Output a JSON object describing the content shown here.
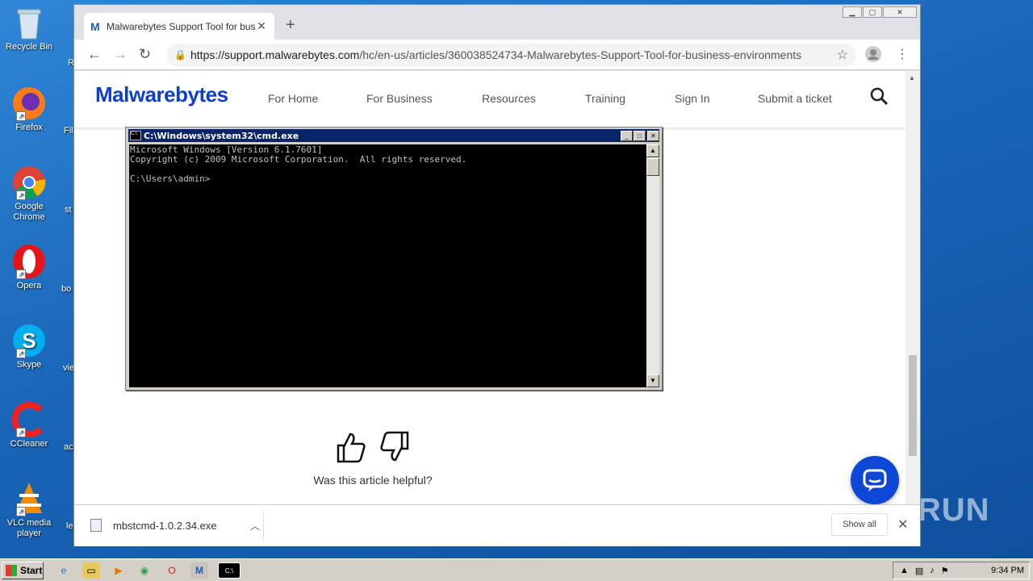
{
  "desktop": {
    "icons": [
      {
        "label": "Recycle Bin",
        "icon": "recycle-bin-icon"
      },
      {
        "label": "Firefox",
        "icon": "firefox-icon"
      },
      {
        "label": "Google Chrome",
        "icon": "chrome-icon"
      },
      {
        "label": "Opera",
        "icon": "opera-icon"
      },
      {
        "label": "Skype",
        "icon": "skype-icon"
      },
      {
        "label": "CCleaner",
        "icon": "ccleaner-icon"
      },
      {
        "label": "VLC media player",
        "icon": "vlc-icon"
      }
    ],
    "peek_labels": [
      "R",
      "Fil",
      "st",
      "bo",
      "vie",
      "ac",
      "le"
    ]
  },
  "browser": {
    "tab_title": "Malwarebytes Support Tool for busin",
    "url_host": "https://support.malwarebytes.com",
    "url_path": "/hc/en-us/articles/360038524734-Malwarebytes-Support-Tool-for-business-environments"
  },
  "site": {
    "logo": "Malwarebytes",
    "nav": [
      "For Home",
      "For Business",
      "Resources",
      "Training",
      "Sign In",
      "Submit a ticket"
    ],
    "helpful_text": "Was this article helpful?"
  },
  "downloads": {
    "file": "mbstcmd-1.0.2.34.exe",
    "show_all": "Show all"
  },
  "cmd": {
    "title": "C:\\Windows\\system32\\cmd.exe",
    "lines": "Microsoft Windows [Version 6.1.7601]\nCopyright (c) 2009 Microsoft Corporation.  All rights reserved.\n\nC:\\Users\\admin>"
  },
  "taskbar": {
    "start": "Start",
    "clock": "9:34 PM"
  },
  "watermark": "ANY RUN",
  "colors": {
    "brand": "#0d3ecc",
    "chat": "#0d47d6",
    "cmd_title": "#0a246a"
  }
}
